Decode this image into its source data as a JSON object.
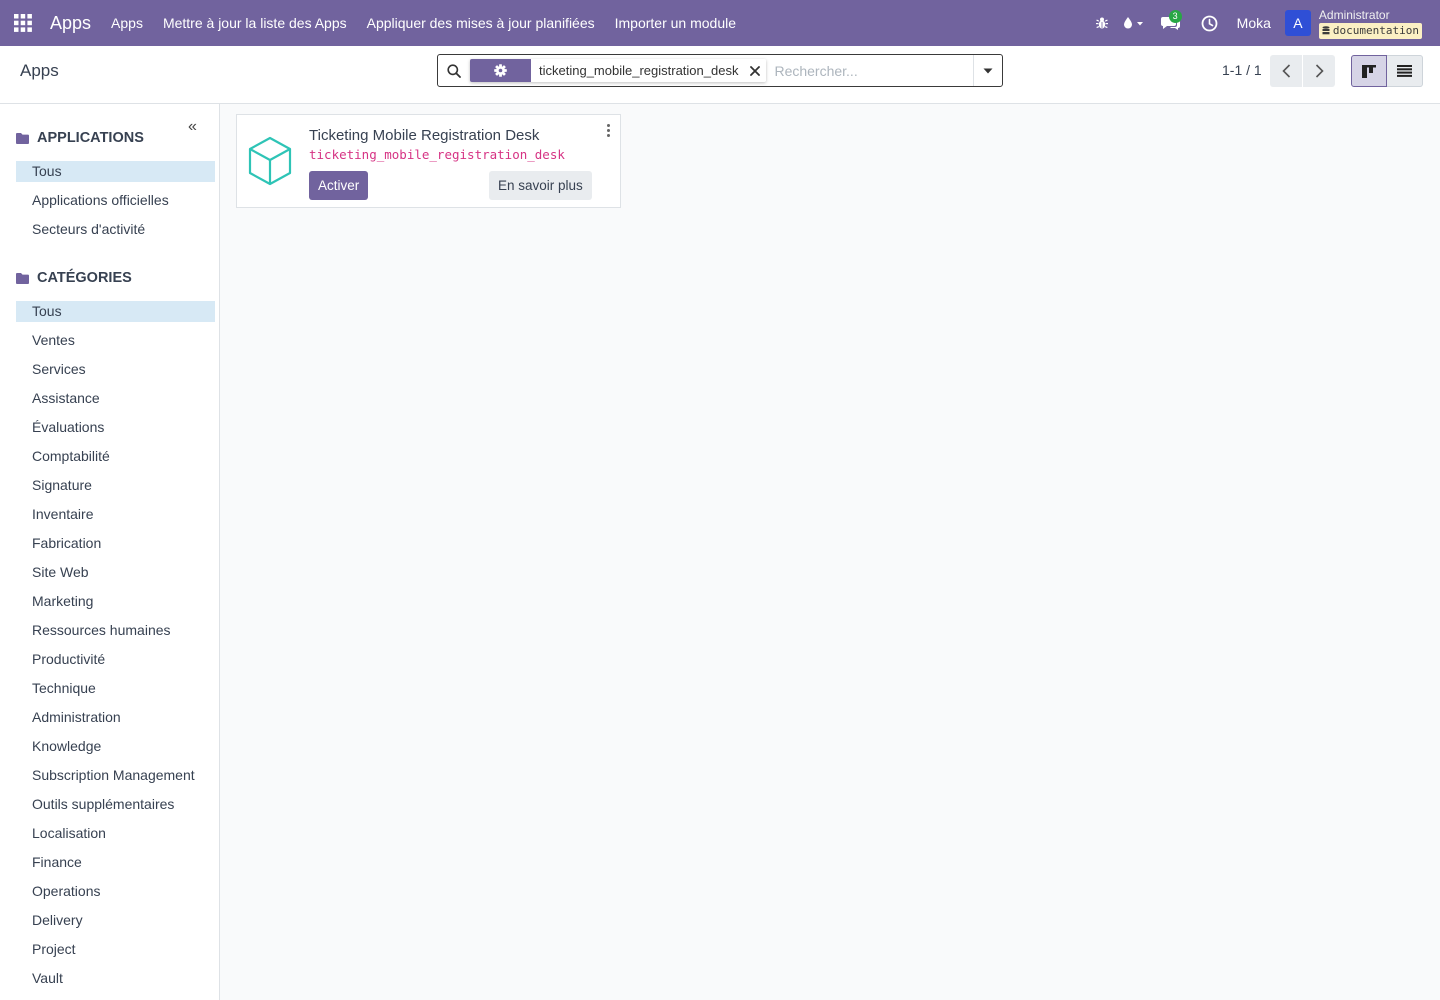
{
  "navbar": {
    "brand": "Apps",
    "menu": [
      "Apps",
      "Mettre à jour la liste des Apps",
      "Appliquer des mises à jour planifiées",
      "Importer un module"
    ],
    "messages_badge": "3",
    "company": "Moka",
    "avatar_letter": "A",
    "user_name": "Administrator",
    "database": "documentation",
    "bg_color": "#71639e"
  },
  "control_panel": {
    "breadcrumb": "Apps",
    "search": {
      "facet_icon": "gear-icon",
      "facet_value": "ticketing_mobile_registration_desk",
      "placeholder": "Rechercher..."
    },
    "pager": "1-1 / 1"
  },
  "sidebar": {
    "applications_title": "APPLICATIONS",
    "applications": [
      {
        "label": "Tous",
        "active": true
      },
      {
        "label": "Applications officielles",
        "active": false
      },
      {
        "label": "Secteurs d'activité",
        "active": false
      }
    ],
    "categories_title": "CATÉGORIES",
    "categories": [
      {
        "label": "Tous",
        "active": true
      },
      {
        "label": "Ventes"
      },
      {
        "label": "Services"
      },
      {
        "label": "Assistance"
      },
      {
        "label": "Évaluations"
      },
      {
        "label": "Comptabilité"
      },
      {
        "label": "Signature"
      },
      {
        "label": "Inventaire"
      },
      {
        "label": "Fabrication"
      },
      {
        "label": "Site Web"
      },
      {
        "label": "Marketing"
      },
      {
        "label": "Ressources humaines"
      },
      {
        "label": "Productivité"
      },
      {
        "label": "Technique"
      },
      {
        "label": "Administration"
      },
      {
        "label": "Knowledge"
      },
      {
        "label": "Subscription Management"
      },
      {
        "label": "Outils supplémentaires"
      },
      {
        "label": "Localisation"
      },
      {
        "label": "Finance"
      },
      {
        "label": "Operations"
      },
      {
        "label": "Delivery"
      },
      {
        "label": "Project"
      },
      {
        "label": "Vault"
      }
    ]
  },
  "module_card": {
    "icon": "cube-icon",
    "title": "Ticketing Mobile Registration Desk",
    "technical_name": "ticketing_mobile_registration_desk",
    "activate_label": "Activer",
    "learn_more_label": "En savoir plus",
    "accent_color": "#2ec4b6"
  }
}
